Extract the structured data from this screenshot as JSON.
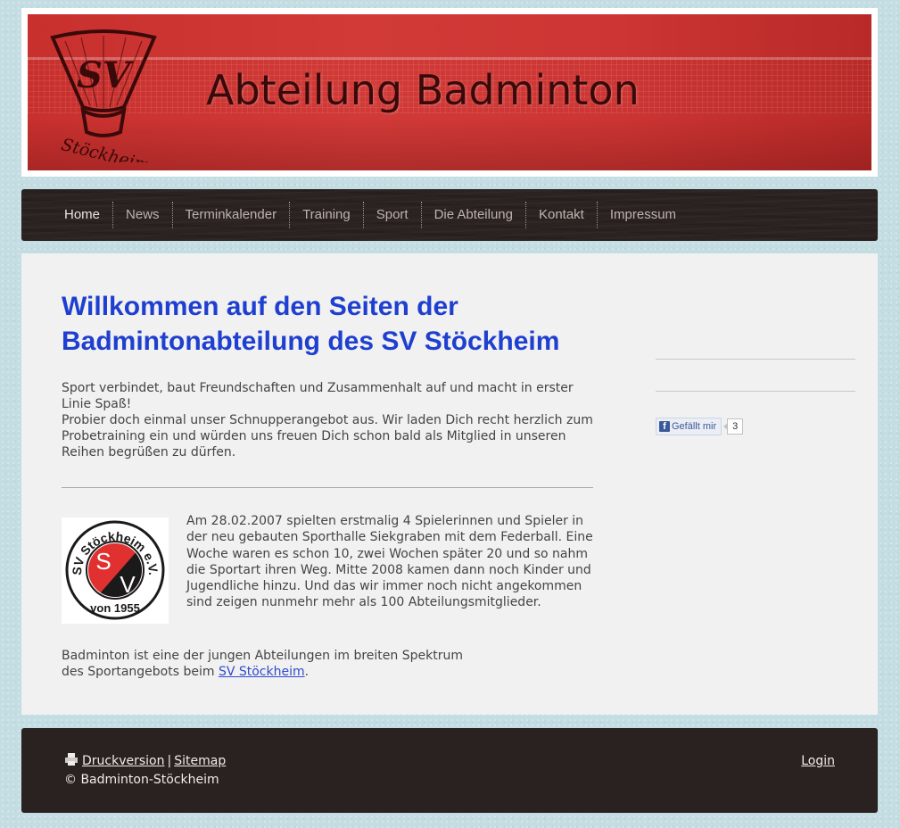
{
  "header": {
    "title": "Abteilung Badminton",
    "logo_text_top": "SV",
    "logo_text_bottom": "Stöckheim"
  },
  "nav": {
    "items": [
      {
        "label": "Home"
      },
      {
        "label": "News"
      },
      {
        "label": "Terminkalender"
      },
      {
        "label": "Training"
      },
      {
        "label": "Sport"
      },
      {
        "label": "Die Abteilung"
      },
      {
        "label": "Kontakt"
      },
      {
        "label": "Impressum"
      }
    ]
  },
  "main": {
    "title": "Willkommen auf den Seiten der Badmintonabteilung des SV Stöckheim",
    "intro_line1": "Sport verbindet, baut Freundschaften und Zusammenhalt auf und macht in erster Linie Spaß!",
    "intro_line2": "Probier doch einmal unser Schnupperangebot aus. Wir laden Dich recht herzlich zum Probetraining ein und würden uns freuen Dich schon bald als Mitglied in unseren Reihen begrüßen zu dürfen.",
    "history": "Am 28.02.2007 spielten erstmalig 4 Spielerinnen und Spieler in der neu gebauten Sporthalle Siekgraben mit dem Federball. Eine Woche waren es schon 10, zwei Wochen später 20 und so nahm die Sportart ihren Weg. Mitte 2008 kamen dann noch Kinder und Jugendliche hinzu. Und das wir immer noch nicht angekommen sind zeigen nunmehr mehr als 100 Abteilungsmitglieder.",
    "closing_before_link": "Badminton ist eine der jungen Abteilungen im breiten Spektrum des Sportangebots beim ",
    "closing_link": "SV Stöckheim",
    "closing_after_link": ".",
    "club_logo": {
      "ring_text": "SV Stöckheim e.V.",
      "letter_top": "S",
      "letter_bottom": "V",
      "year": "von 1955"
    }
  },
  "sidebar": {
    "fb_like_label": "Gefällt mir",
    "fb_like_count": "3"
  },
  "footer": {
    "print_label": "Druckversion",
    "separator": "|",
    "sitemap_label": "Sitemap",
    "copyright": "© Badminton-Stöckheim",
    "login_label": "Login"
  },
  "colors": {
    "title_blue": "#1e3fcf",
    "banner_red": "#c8302e",
    "dark_brown": "#2a2220",
    "background": "#c4dde2"
  }
}
